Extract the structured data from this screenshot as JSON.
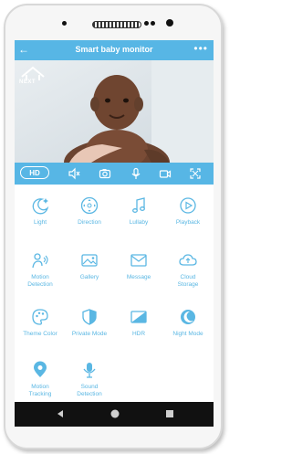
{
  "header": {
    "title": "Smart baby monitor",
    "back_icon": "back-arrow-icon",
    "more_icon": "more-dots-icon"
  },
  "video": {
    "brand": "NEXT"
  },
  "controls": {
    "hd_label": "HD"
  },
  "grid": [
    {
      "label": "Light",
      "icon": "moon-star-icon"
    },
    {
      "label": "Direction",
      "icon": "direction-pad-icon"
    },
    {
      "label": "Lullaby",
      "icon": "music-note-icon"
    },
    {
      "label": "Playback",
      "icon": "play-circle-icon"
    },
    {
      "label": "Motion\nDetection",
      "icon": "motion-person-icon"
    },
    {
      "label": "Gallery",
      "icon": "gallery-icon"
    },
    {
      "label": "Message",
      "icon": "envelope-icon"
    },
    {
      "label": "Cloud\nStorage",
      "icon": "cloud-icon"
    },
    {
      "label": "Theme Color",
      "icon": "palette-icon"
    },
    {
      "label": "Private Mode",
      "icon": "shield-icon"
    },
    {
      "label": "HDR",
      "icon": "hdr-icon"
    },
    {
      "label": "Night Mode",
      "icon": "moon-icon"
    },
    {
      "label": "Motion\nTracking",
      "icon": "location-pin-icon"
    },
    {
      "label": "Sound\nDetection",
      "icon": "microphone-icon"
    }
  ],
  "colors": {
    "accent": "#57b6e5",
    "label": "#5ab7e3",
    "navbar": "#111111"
  }
}
